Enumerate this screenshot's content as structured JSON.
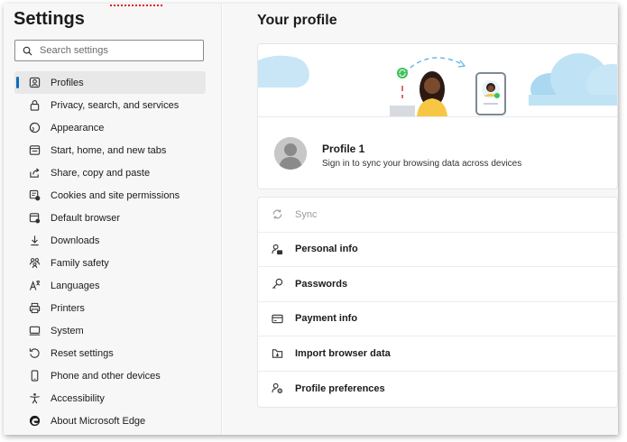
{
  "sidebar": {
    "title": "Settings",
    "search": {
      "placeholder": "Search settings"
    },
    "items": [
      {
        "label": "Profiles",
        "icon": "profiles-icon",
        "active": true
      },
      {
        "label": "Privacy, search, and services",
        "icon": "lock-icon"
      },
      {
        "label": "Appearance",
        "icon": "appearance-icon"
      },
      {
        "label": "Start, home, and new tabs",
        "icon": "start-home-icon"
      },
      {
        "label": "Share, copy and paste",
        "icon": "share-icon"
      },
      {
        "label": "Cookies and site permissions",
        "icon": "cookies-icon"
      },
      {
        "label": "Default browser",
        "icon": "default-browser-icon"
      },
      {
        "label": "Downloads",
        "icon": "download-icon"
      },
      {
        "label": "Family safety",
        "icon": "family-icon"
      },
      {
        "label": "Languages",
        "icon": "languages-icon"
      },
      {
        "label": "Printers",
        "icon": "printer-icon"
      },
      {
        "label": "System",
        "icon": "system-icon"
      },
      {
        "label": "Reset settings",
        "icon": "reset-icon"
      },
      {
        "label": "Phone and other devices",
        "icon": "phone-icon"
      },
      {
        "label": "Accessibility",
        "icon": "accessibility-icon"
      },
      {
        "label": "About Microsoft Edge",
        "icon": "edge-logo-icon"
      }
    ]
  },
  "main": {
    "title": "Your profile",
    "profile": {
      "name": "Profile 1",
      "subtitle": "Sign in to sync your browsing data across devices"
    },
    "items": [
      {
        "label": "Sync",
        "icon": "sync-icon",
        "disabled": true
      },
      {
        "label": "Personal info",
        "icon": "personal-info-icon"
      },
      {
        "label": "Passwords",
        "icon": "key-icon"
      },
      {
        "label": "Payment info",
        "icon": "credit-card-icon"
      },
      {
        "label": "Import browser data",
        "icon": "import-icon"
      },
      {
        "label": "Profile preferences",
        "icon": "profile-preferences-icon"
      }
    ]
  },
  "colors": {
    "accent": "#0f6cbd",
    "sidebar_bg": "#f7f7f7",
    "banner_cloud": "#a9d8f0"
  }
}
